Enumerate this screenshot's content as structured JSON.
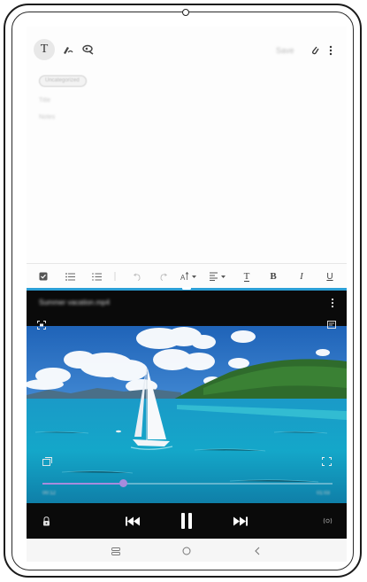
{
  "notes": {
    "pen_mode_label": "T",
    "save_label": "Save",
    "category_label": "Uncategorized",
    "title_placeholder": "Title",
    "body_placeholder": "Notes"
  },
  "format_toolbar": {
    "items": [
      "checkbox-icon",
      "bulleted-list-icon",
      "numbered-list-icon",
      "undo-icon",
      "redo-icon",
      "font-size-icon",
      "align-icon",
      "text-color-icon",
      "bold-icon",
      "italic-icon",
      "underline-icon"
    ],
    "bold_label": "B",
    "italic_label": "I",
    "underline_label": "U",
    "text_color_label": "T"
  },
  "video": {
    "title": "Summer vacation.mp4",
    "current_time": "00:12",
    "total_time": "01:03",
    "progress_fraction": 0.28,
    "accent_color": "#a78bdd"
  },
  "colors": {
    "split_divider": "#2b9fd6",
    "video_bg": "#0a0a0a"
  }
}
